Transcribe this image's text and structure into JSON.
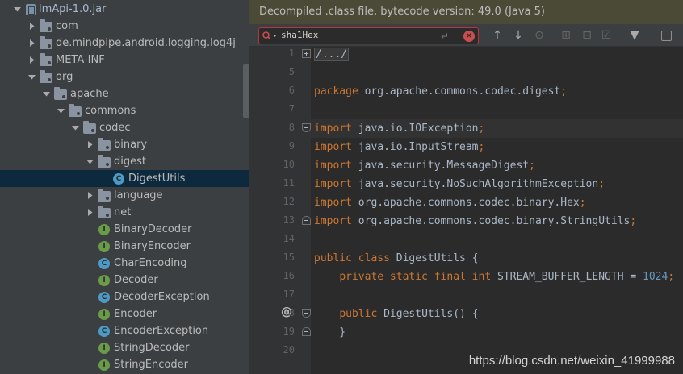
{
  "tree": {
    "items": [
      {
        "label": "lmApi-1.0.jar",
        "icon": "jar-icon",
        "indent": 0,
        "arrow": "down",
        "kind": "jar"
      },
      {
        "label": "com",
        "icon": "package-icon",
        "indent": 1,
        "arrow": "right",
        "kind": "folder"
      },
      {
        "label": "de.mindpipe.android.logging.log4j",
        "icon": "package-icon",
        "indent": 1,
        "arrow": "right",
        "kind": "folder"
      },
      {
        "label": "META-INF",
        "icon": "package-icon",
        "indent": 1,
        "arrow": "right",
        "kind": "folder"
      },
      {
        "label": "org",
        "icon": "package-icon",
        "indent": 1,
        "arrow": "down",
        "kind": "folder"
      },
      {
        "label": "apache",
        "icon": "package-icon",
        "indent": 2,
        "arrow": "down",
        "kind": "folder"
      },
      {
        "label": "commons",
        "icon": "package-icon",
        "indent": 3,
        "arrow": "down",
        "kind": "folder"
      },
      {
        "label": "codec",
        "icon": "package-icon",
        "indent": 4,
        "arrow": "down",
        "kind": "folder"
      },
      {
        "label": "binary",
        "icon": "package-icon",
        "indent": 5,
        "arrow": "right",
        "kind": "folder"
      },
      {
        "label": "digest",
        "icon": "package-icon",
        "indent": 5,
        "arrow": "down",
        "kind": "folder"
      },
      {
        "label": "DigestUtils",
        "icon": "class-icon",
        "indent": 6,
        "arrow": "none",
        "kind": "class",
        "selected": true
      },
      {
        "label": "language",
        "icon": "package-icon",
        "indent": 5,
        "arrow": "right",
        "kind": "folder"
      },
      {
        "label": "net",
        "icon": "package-icon",
        "indent": 5,
        "arrow": "right",
        "kind": "folder"
      },
      {
        "label": "BinaryDecoder",
        "icon": "interface-icon",
        "indent": 5,
        "arrow": "none",
        "kind": "iface"
      },
      {
        "label": "BinaryEncoder",
        "icon": "interface-icon",
        "indent": 5,
        "arrow": "none",
        "kind": "iface"
      },
      {
        "label": "CharEncoding",
        "icon": "class-icon",
        "indent": 5,
        "arrow": "none",
        "kind": "class"
      },
      {
        "label": "Decoder",
        "icon": "interface-icon",
        "indent": 5,
        "arrow": "none",
        "kind": "iface"
      },
      {
        "label": "DecoderException",
        "icon": "class-icon",
        "indent": 5,
        "arrow": "none",
        "kind": "class"
      },
      {
        "label": "Encoder",
        "icon": "interface-icon",
        "indent": 5,
        "arrow": "none",
        "kind": "iface"
      },
      {
        "label": "EncoderException",
        "icon": "class-icon",
        "indent": 5,
        "arrow": "none",
        "kind": "class"
      },
      {
        "label": "StringDecoder",
        "icon": "interface-icon",
        "indent": 5,
        "arrow": "none",
        "kind": "iface"
      },
      {
        "label": "StringEncoder",
        "icon": "interface-icon",
        "indent": 5,
        "arrow": "none",
        "kind": "iface"
      }
    ]
  },
  "editor": {
    "banner": "Decompiled .class file, bytecode version: 49.0 (Java 5)",
    "search": {
      "value": "sha1Hex"
    },
    "toolbar_icons": [
      "arrow-up-icon",
      "arrow-down-icon",
      "find-occurrences-icon",
      "add-occurrence-icon",
      "remove-occurrence-icon",
      "select-all-occurrences-icon",
      "filter-icon",
      "match-case-checkbox"
    ],
    "lines": [
      {
        "no": "1",
        "tokens": [
          [
            "collapsed",
            "/.../"
          ]
        ]
      },
      {
        "no": "5",
        "tokens": []
      },
      {
        "no": "6",
        "tokens": [
          [
            "kw",
            "package "
          ],
          [
            "",
            "org.apache.commons.codec.digest"
          ],
          [
            "punc",
            ";"
          ]
        ]
      },
      {
        "no": "7",
        "tokens": []
      },
      {
        "no": "8",
        "tokens": [
          [
            "kw",
            "import "
          ],
          [
            "",
            "java.io.IOException"
          ],
          [
            "punc",
            ";"
          ]
        ],
        "current": true
      },
      {
        "no": "9",
        "tokens": [
          [
            "kw",
            "import "
          ],
          [
            "",
            "java.io.InputStream"
          ],
          [
            "punc",
            ";"
          ]
        ]
      },
      {
        "no": "10",
        "tokens": [
          [
            "kw",
            "import "
          ],
          [
            "",
            "java.security.MessageDigest"
          ],
          [
            "punc",
            ";"
          ]
        ]
      },
      {
        "no": "11",
        "tokens": [
          [
            "kw",
            "import "
          ],
          [
            "",
            "java.security.NoSuchAlgorithmException"
          ],
          [
            "punc",
            ";"
          ]
        ]
      },
      {
        "no": "12",
        "tokens": [
          [
            "kw",
            "import "
          ],
          [
            "",
            "org.apache.commons.codec.binary.Hex"
          ],
          [
            "punc",
            ";"
          ]
        ]
      },
      {
        "no": "13",
        "tokens": [
          [
            "kw",
            "import "
          ],
          [
            "",
            "org.apache.commons.codec.binary.StringUtils"
          ],
          [
            "punc",
            ";"
          ]
        ]
      },
      {
        "no": "14",
        "tokens": []
      },
      {
        "no": "15",
        "tokens": [
          [
            "kw",
            "public class "
          ],
          [
            "",
            "DigestUtils {"
          ]
        ]
      },
      {
        "no": "16",
        "tokens": [
          [
            "",
            "    "
          ],
          [
            "kw",
            "private static final int "
          ],
          [
            "",
            "STREAM_BUFFER_LENGTH = "
          ],
          [
            "num",
            "1024"
          ],
          [
            "punc",
            ";"
          ]
        ]
      },
      {
        "no": "17",
        "tokens": []
      },
      {
        "no": "18",
        "tokens": [
          [
            "",
            "    "
          ],
          [
            "kw",
            "public "
          ],
          [
            "",
            "DigestUtils() {"
          ]
        ]
      },
      {
        "no": "19",
        "tokens": [
          [
            "",
            "    }"
          ]
        ]
      },
      {
        "no": "20",
        "tokens": []
      }
    ]
  },
  "watermark": "https://blog.csdn.net/weixin_41999988",
  "colors": {
    "tree_bg": "#3c3f41",
    "editor_bg": "#2b2b2b",
    "banner_bg": "#4b4a36",
    "keyword": "#cc7832",
    "number": "#6897bb",
    "selection": "#0d293e"
  }
}
